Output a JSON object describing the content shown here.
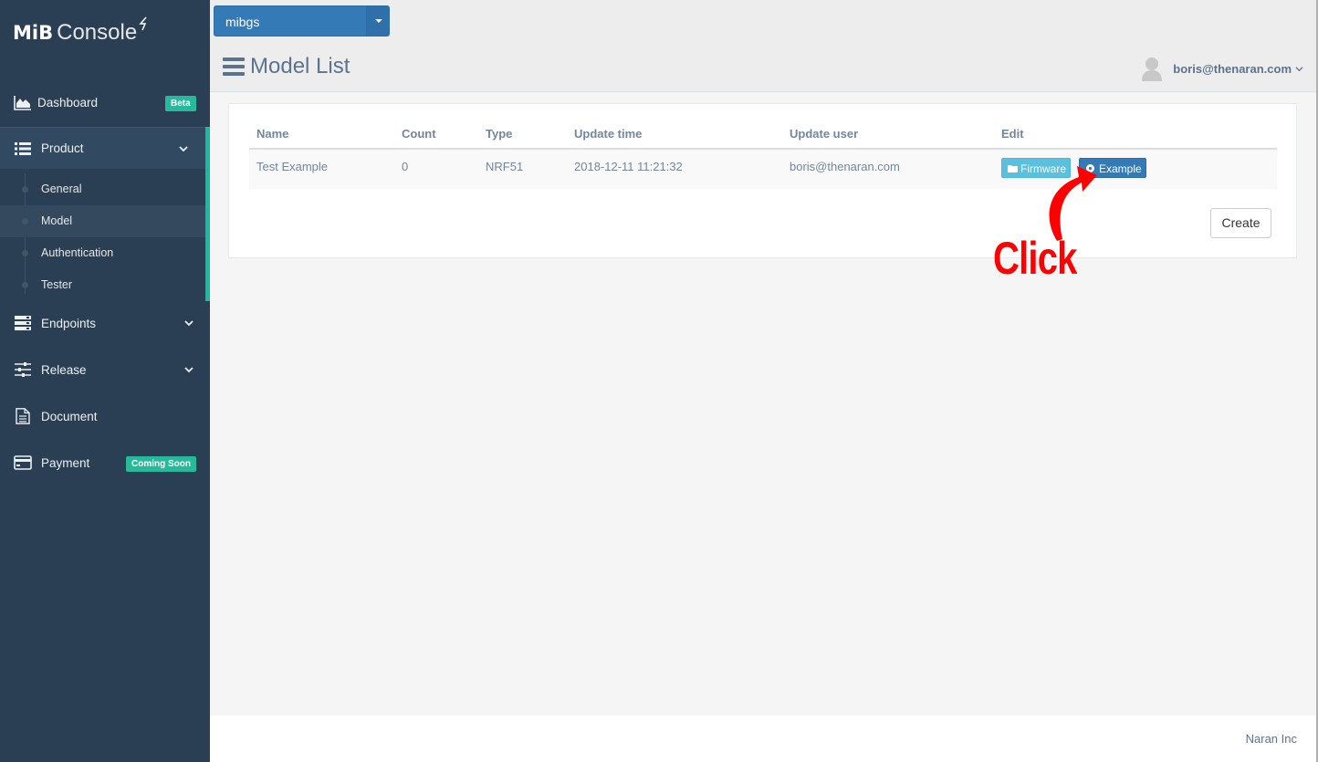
{
  "app": {
    "logo_bold": "MiB",
    "logo_light": "Console"
  },
  "project_select": {
    "value": "mibgs"
  },
  "header": {
    "title": "Model List",
    "user_email": "boris@thenaran.com"
  },
  "sidebar": {
    "items": [
      {
        "label": "Dashboard",
        "badge": "Beta",
        "icon": "area-chart-icon"
      },
      {
        "label": "Product",
        "icon": "list-icon",
        "expanded": true
      },
      {
        "label": "Endpoints",
        "icon": "server-icon"
      },
      {
        "label": "Release",
        "icon": "sliders-icon"
      },
      {
        "label": "Document",
        "icon": "document-icon"
      },
      {
        "label": "Payment",
        "badge": "Coming Soon",
        "icon": "credit-card-icon"
      }
    ],
    "product_sub": [
      "General",
      "Model",
      "Authentication",
      "Tester"
    ],
    "active_sub": "Model"
  },
  "table": {
    "columns": [
      "Name",
      "Count",
      "Type",
      "Update time",
      "Update user",
      "Edit"
    ],
    "rows": [
      {
        "name": "Test Example",
        "count": "0",
        "type": "NRF51",
        "update_time": "2018-12-11 11:21:32",
        "update_user": "boris@thenaran.com",
        "firmware_label": "Firmware",
        "example_label": "Example"
      }
    ]
  },
  "create_label": "Create",
  "annotation": {
    "text": "Click"
  },
  "footer": {
    "text": "Naran Inc"
  },
  "colors": {
    "sidebar": "#2a3f54",
    "accent_green": "#1abb9c",
    "primary": "#337ab7",
    "info": "#5bc0de",
    "annotation": "#ff0000"
  }
}
